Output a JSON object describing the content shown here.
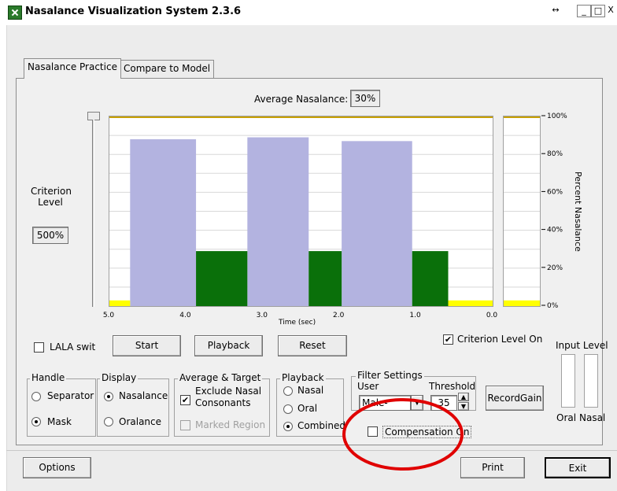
{
  "window": {
    "title": "Nasalance Visualization System 2.3.6",
    "resize_glyph": "↔",
    "minimize_glyph": "_",
    "maximize_glyph": "□",
    "close_glyph": "X"
  },
  "tabs": [
    {
      "label": "Nasalance Practice",
      "active": true
    },
    {
      "label": "Compare to Model",
      "active": false
    }
  ],
  "average": {
    "label": "Average Nasalance:",
    "value": "30%"
  },
  "criterion": {
    "label_line1": "Criterion",
    "label_line2": "Level",
    "value": "500%"
  },
  "chart_data": {
    "type": "bar",
    "xlabel": "Time (sec)",
    "ylabel": "Percent Nasalance",
    "xticks": [
      "5.0",
      "4.0",
      "3.0",
      "2.0",
      "1.0",
      "0.0"
    ],
    "xlim": [
      5.0,
      0.0
    ],
    "ylim": [
      0,
      100
    ],
    "yticks": [
      "100%",
      "80%",
      "60%",
      "40%",
      "20%",
      "0%"
    ],
    "series": [
      {
        "color": "#b3b3e0",
        "segments": [
          {
            "x0": 4.73,
            "x1": 3.87,
            "y": 88
          },
          {
            "x0": 3.2,
            "x1": 2.4,
            "y": 89
          },
          {
            "x0": 1.97,
            "x1": 1.05,
            "y": 87
          }
        ]
      },
      {
        "color": "#0a700a",
        "segments": [
          {
            "x0": 3.87,
            "x1": 3.2,
            "y": 29
          },
          {
            "x0": 2.4,
            "x1": 1.97,
            "y": 29
          },
          {
            "x0": 1.05,
            "x1": 0.58,
            "y": 29
          }
        ]
      },
      {
        "color": "#ffff00",
        "segments": [
          {
            "x0": 5.0,
            "x1": 4.73,
            "y": 3
          },
          {
            "x0": 0.58,
            "x1": 0.0,
            "y": 3
          }
        ]
      }
    ],
    "side_bar": {
      "color": "#ffff00",
      "y": 3
    },
    "grid": true
  },
  "controls": {
    "lala_switch": {
      "label": "LALA switch",
      "checked": false
    },
    "start": "Start",
    "playback": "Playback",
    "reset": "Reset",
    "criterion_on": {
      "label": "Criterion Level On",
      "checked": true
    },
    "input_level": {
      "title": "Input Level",
      "oral": "Oral",
      "nasal": "Nasal"
    }
  },
  "groups": {
    "handle": {
      "title": "Handle",
      "options": [
        "Separator",
        "Mask"
      ],
      "selected": "Mask"
    },
    "display": {
      "title": "Display",
      "options": [
        "Nasalance",
        "Oralance"
      ],
      "selected": "Nasalance"
    },
    "avg_target": {
      "title": "Average & Target",
      "exclude_line1": "Exclude Nasal",
      "exclude_line2": "Consonants",
      "exclude_checked": true,
      "marked_region": "Marked Region",
      "marked_checked": false
    },
    "playback": {
      "title": "Playback",
      "options": [
        "Nasal",
        "Oral",
        "Combined"
      ],
      "selected": "Combined"
    },
    "filter": {
      "title": "Filter Settings",
      "user_label": "User",
      "user_value": "Male-Femi",
      "threshold_label": "Threshold",
      "threshold_value": "35",
      "compensation": "Compensation On",
      "compensation_checked": false
    }
  },
  "record_gain": "RecordGain",
  "bottom": {
    "options": "Options",
    "print": "Print",
    "exit": "Exit"
  },
  "annotation": {
    "color": "#e00000"
  }
}
